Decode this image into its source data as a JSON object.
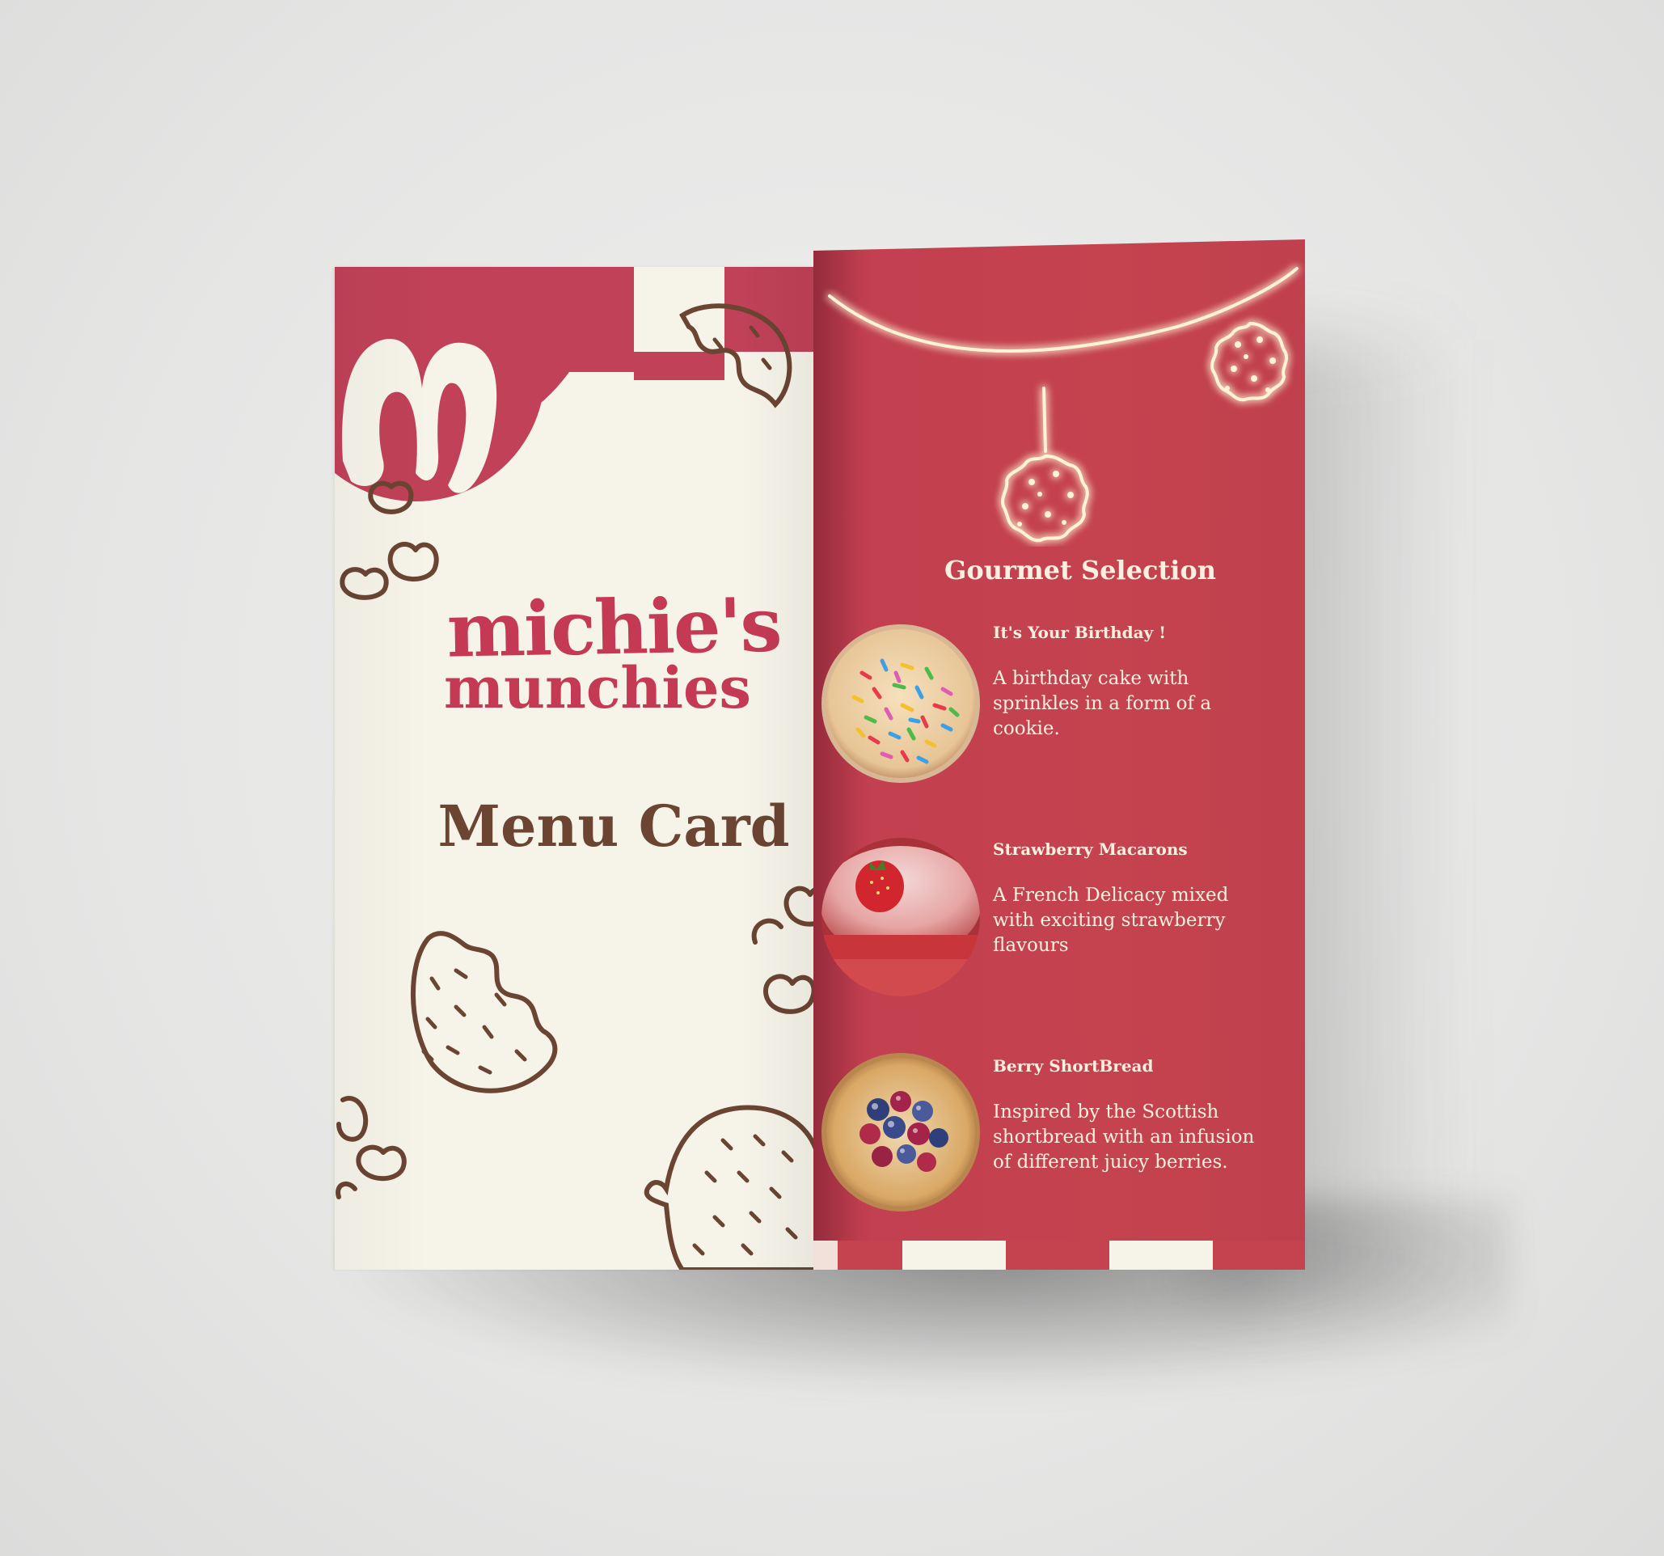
{
  "cover": {
    "brand_line1": "michie's",
    "brand_line2": "munchies",
    "title": "Menu Card",
    "colors": {
      "background": "#f6f3e9",
      "brand_red": "#c43a55",
      "cookie_brown": "#6b4432"
    }
  },
  "inside": {
    "section_title": "Gourmet Selection",
    "items": [
      {
        "name": "It's Your Birthday !",
        "description": "A birthday cake with sprinkles in a form of a cookie.",
        "image": "sprinkle-cookie"
      },
      {
        "name": "Strawberry Macarons",
        "description": "A French Delicacy mixed with exciting strawberry flavours",
        "image": "strawberry-macaron"
      },
      {
        "name": "Berry ShortBread",
        "description": "Inspired by the Scottish shortbread with an infusion of different juicy berries.",
        "image": "berry-shortbread"
      }
    ],
    "colors": {
      "background": "#c5434f",
      "text": "#fbefe0",
      "glow": "#fff3d6"
    }
  }
}
